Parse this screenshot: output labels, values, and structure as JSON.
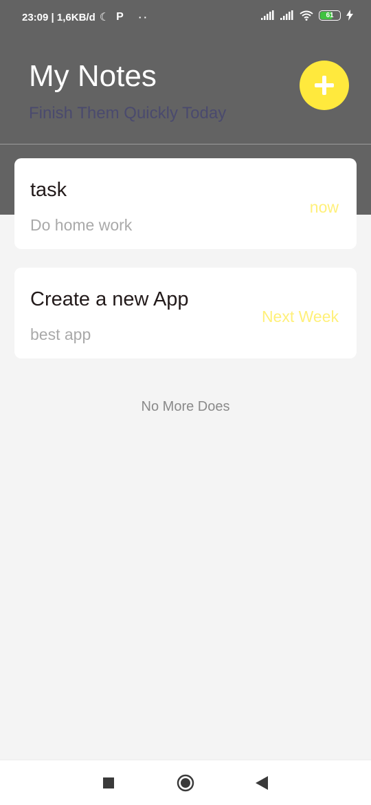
{
  "status_bar": {
    "time_speed": "23:09 | 1,6KB/d",
    "moon_icon": "moon-icon",
    "p_icon": "P",
    "dots": "··",
    "battery_level": "61"
  },
  "header": {
    "title": "My Notes",
    "subtitle": "Finish Them Quickly Today",
    "add_icon": "plus-icon"
  },
  "notes": [
    {
      "title": "task",
      "body": "Do home work",
      "due": "now"
    },
    {
      "title": "Create a new App",
      "body": "best app",
      "due": "Next Week"
    }
  ],
  "list_end_text": "No More Does",
  "colors": {
    "header_bg": "#636363",
    "accent": "#ffe93d",
    "due_text": "#fff07a",
    "subtitle": "#4a4a6e"
  }
}
